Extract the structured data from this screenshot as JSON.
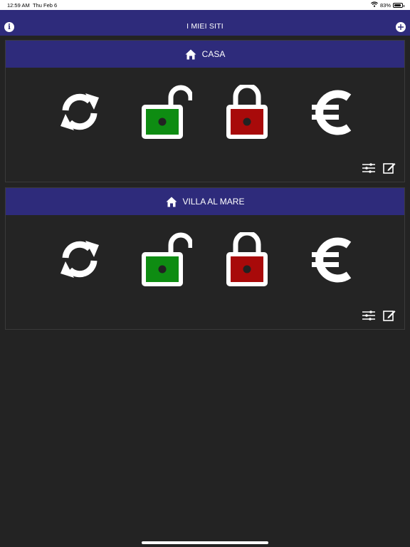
{
  "status_bar": {
    "time": "12:59 AM",
    "date": "Thu Feb 6",
    "battery": "83%"
  },
  "nav": {
    "title": "I MIEI SITI"
  },
  "sites": [
    {
      "name": "CASA"
    },
    {
      "name": "VILLA AL MARE"
    }
  ],
  "colors": {
    "nav_background": "#2e2b7b",
    "page_background": "#232323",
    "unlock_fill": "#0e8c12",
    "lock_fill": "#a80a0a"
  },
  "icons": [
    "info-icon",
    "plus-icon",
    "home-icon",
    "refresh-icon",
    "unlocked-padlock-icon",
    "locked-padlock-icon",
    "euro-icon",
    "sliders-icon",
    "edit-icon"
  ]
}
